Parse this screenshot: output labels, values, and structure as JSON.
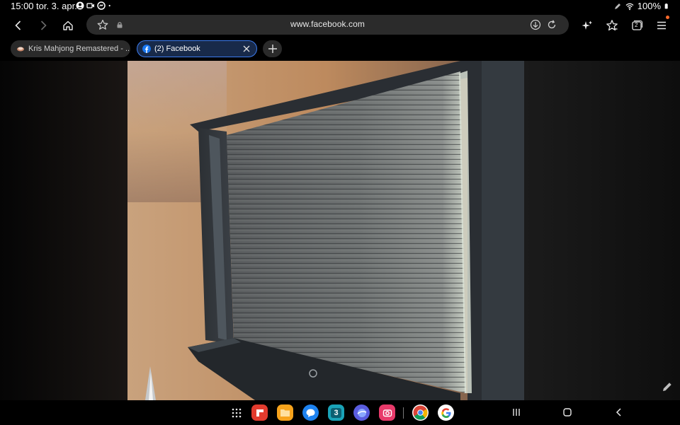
{
  "status_bar": {
    "time": "15:00",
    "date": "tor. 3. apr.",
    "battery": "100%",
    "icons": [
      "account-circle-icon",
      "video-call-icon",
      "messenger-icon",
      "dot-icon"
    ],
    "right_icons": [
      "pen-icon",
      "wifi-icon",
      "battery-icon"
    ]
  },
  "toolbar": {
    "url": "www.facebook.com",
    "icons": [
      "back-icon",
      "forward-icon",
      "home-icon",
      "bookmark-star-icon",
      "lock-icon",
      "download-icon",
      "reload-icon",
      "ai-sparkle-icon",
      "favorites-icon",
      "tabs-icon",
      "menu-icon"
    ],
    "tab_count": "2",
    "accent": "#ff6a2b"
  },
  "tabs": [
    {
      "label": "Kris Mahjong Remastered - ...",
      "favicon": "mahjong-icon",
      "active": false
    },
    {
      "label": "(2) Facebook",
      "favicon": "facebook-icon",
      "active": true
    }
  ],
  "colors": {
    "active_tab_border": "#3c7cf0",
    "facebook_blue": "#1877f2",
    "url_bar_bg": "#2b2b2b"
  },
  "dock": {
    "apps": [
      "app-drawer-icon",
      "flipboard-icon",
      "files-icon",
      "messages-icon",
      "calendar-icon",
      "internet-icon",
      "camera-icon",
      "chrome-icon",
      "google-icon"
    ],
    "calendar_day": "3",
    "nav": [
      "recents-icon",
      "home-nav-icon",
      "back-nav-icon"
    ]
  }
}
